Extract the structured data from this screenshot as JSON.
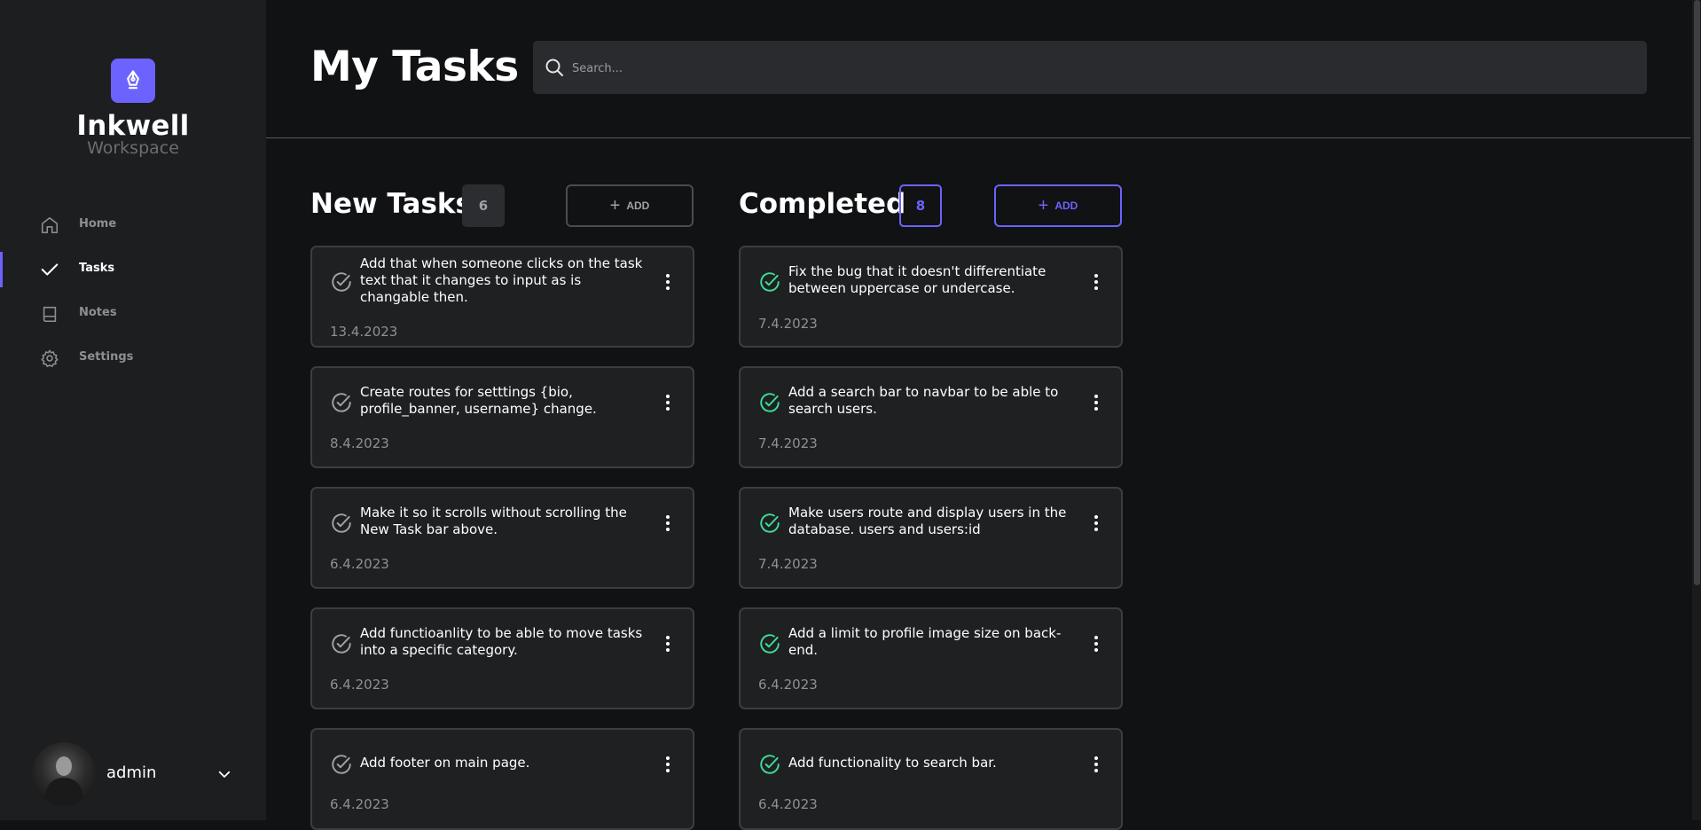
{
  "brand": {
    "name": "Inkwell",
    "subtitle": "Workspace"
  },
  "nav": [
    {
      "label": "Home",
      "icon": "home-icon",
      "active": false
    },
    {
      "label": "Tasks",
      "icon": "check-icon",
      "active": true
    },
    {
      "label": "Notes",
      "icon": "book-icon",
      "active": false
    },
    {
      "label": "Settings",
      "icon": "gear-icon",
      "active": false
    }
  ],
  "user": {
    "name": "admin"
  },
  "page": {
    "title": "My Tasks"
  },
  "search": {
    "placeholder": "Search..."
  },
  "columns": {
    "new": {
      "title": "New Tasks",
      "count": "6",
      "add_label": "ADD",
      "tasks": [
        {
          "text": "Add that when someone clicks on the task text that it changes to input as is changable then.",
          "date": "13.4.2023"
        },
        {
          "text": "Create routes for setttings {bio, profile_banner, username} change.",
          "date": "8.4.2023"
        },
        {
          "text": "Make it so it scrolls without scrolling the New Task bar above.",
          "date": "6.4.2023"
        },
        {
          "text": "Add functioanlity to be able to move tasks into a specific category.",
          "date": "6.4.2023"
        },
        {
          "text": "Add footer on main page.",
          "date": "6.4.2023"
        }
      ]
    },
    "completed": {
      "title": "Completed",
      "count": "8",
      "add_label": "ADD",
      "tasks": [
        {
          "text": "Fix the bug that it doesn't differentiate between uppercase or undercase.",
          "date": "7.4.2023"
        },
        {
          "text": "Add a search bar to navbar to be able to search users.",
          "date": "7.4.2023"
        },
        {
          "text": "Make users route and display users in the database. users and users:id",
          "date": "7.4.2023"
        },
        {
          "text": "Add a limit to profile image size on back-end.",
          "date": "6.4.2023"
        },
        {
          "text": "Add functionality to search bar.",
          "date": "6.4.2023"
        }
      ]
    }
  },
  "colors": {
    "accent": "#6c63ff",
    "success": "#3ddc97",
    "background": "#111214",
    "sidebar": "#1d1e20",
    "card": "#1f2022"
  }
}
